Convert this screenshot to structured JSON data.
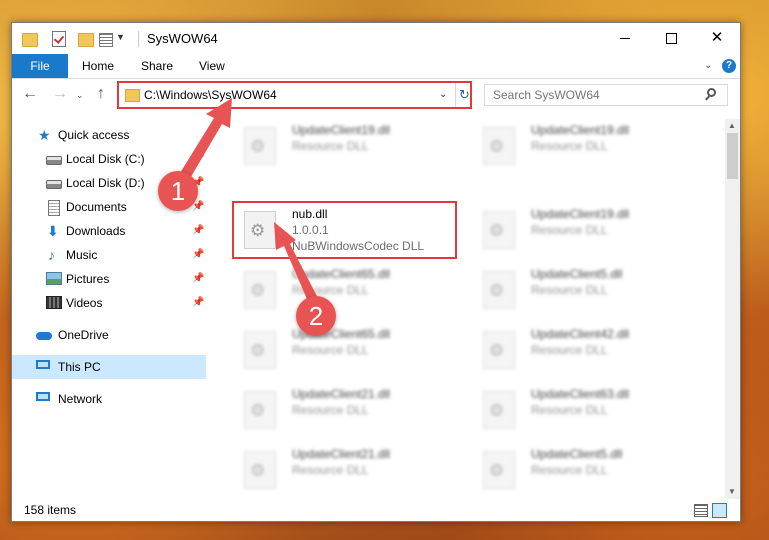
{
  "window": {
    "title": "SysWOW64",
    "minimize_icon": "minimize-icon",
    "maximize_icon": "maximize-icon",
    "close_glyph": "✕"
  },
  "ribbon": {
    "tabs": [
      {
        "label": "File"
      },
      {
        "label": "Home"
      },
      {
        "label": "Share"
      },
      {
        "label": "View"
      }
    ],
    "help_glyph": "?",
    "expand_glyph": "⌄"
  },
  "address_bar": {
    "path": "C:\\Windows\\SysWOW64",
    "refresh_glyph": "↻",
    "dropdown_glyph": "⌄"
  },
  "nav_buttons": {
    "back_glyph": "←",
    "forward_glyph": "→",
    "recent_glyph": "⌄",
    "up_glyph": "↑"
  },
  "search": {
    "placeholder": "Search SysWOW64"
  },
  "nav_pane": {
    "items": [
      {
        "label": "Quick access"
      },
      {
        "label": "Local Disk (C:)"
      },
      {
        "label": "Local Disk (D:)"
      },
      {
        "label": "Documents"
      },
      {
        "label": "Downloads"
      },
      {
        "label": "Music"
      },
      {
        "label": "Pictures"
      },
      {
        "label": "Videos"
      },
      {
        "label": "OneDrive"
      },
      {
        "label": "This PC"
      },
      {
        "label": "Network"
      }
    ],
    "pin_glyph": "📌"
  },
  "files": {
    "highlighted": {
      "name": "nub.dll",
      "version": "1.0.0.1",
      "description": "NuBWindowsCodec DLL"
    },
    "left_column": [
      {
        "name": "UpdateClient19.dll",
        "type": "Resource DLL"
      },
      {
        "name": "UpdateClient65.dll",
        "type": "Resource DLL"
      },
      {
        "name": "UpdateClient65.dll",
        "type": "Resource DLL"
      },
      {
        "name": "UpdateClient21.dll",
        "type": "Resource DLL"
      },
      {
        "name": "UpdateClient21.dll",
        "type": "Resource DLL"
      }
    ],
    "right_column": [
      {
        "name": "UpdateClient19.dll",
        "type": "Resource DLL"
      },
      {
        "name": "UpdateClient19.dll",
        "type": "Resource DLL"
      },
      {
        "name": "UpdateClient5.dll",
        "type": "Resource DLL"
      },
      {
        "name": "UpdateClient42.dll",
        "type": "Resource DLL"
      },
      {
        "name": "UpdateClient63.dll",
        "type": "Resource DLL"
      },
      {
        "name": "UpdateClient5.dll",
        "type": "Resource DLL"
      }
    ]
  },
  "status_bar": {
    "item_count": "158 items"
  },
  "annotations": {
    "step1": "1",
    "step2": "2",
    "color": "#e85353"
  }
}
